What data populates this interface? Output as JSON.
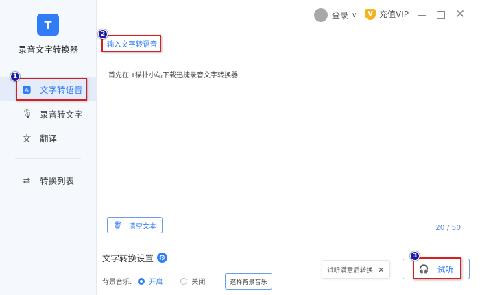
{
  "app": {
    "name": "录音文字转换器",
    "logo_letter": "T"
  },
  "sidebar": {
    "items": [
      {
        "label": "文字转语音",
        "icon": "text-a-icon"
      },
      {
        "label": "录音转文字",
        "icon": "microphone-icon"
      },
      {
        "label": "翻译",
        "icon": "translate-icon"
      },
      {
        "label": "转换列表",
        "icon": "list-convert-icon"
      }
    ]
  },
  "header": {
    "login": "登录",
    "vip": "充值VIP",
    "vip_letter": "V"
  },
  "tab": {
    "label": "输入文字转语音"
  },
  "editor": {
    "text": "首先在IT猫扑小站下载迅捷录音文字转换器",
    "clear": "清空文本",
    "counter": "20 / 50"
  },
  "settings": {
    "title": "文字转换设置",
    "bg_music_label": "背景音乐:",
    "on": "开启",
    "off": "关闭",
    "choose": "选择背景音乐"
  },
  "tooltip": {
    "text": "试听满意后转换",
    "close": "×"
  },
  "listen": {
    "label": "试听"
  },
  "annotations": [
    "1",
    "2",
    "3"
  ],
  "colors": {
    "accent": "#2f7cf6",
    "highlight": "#d42020"
  }
}
